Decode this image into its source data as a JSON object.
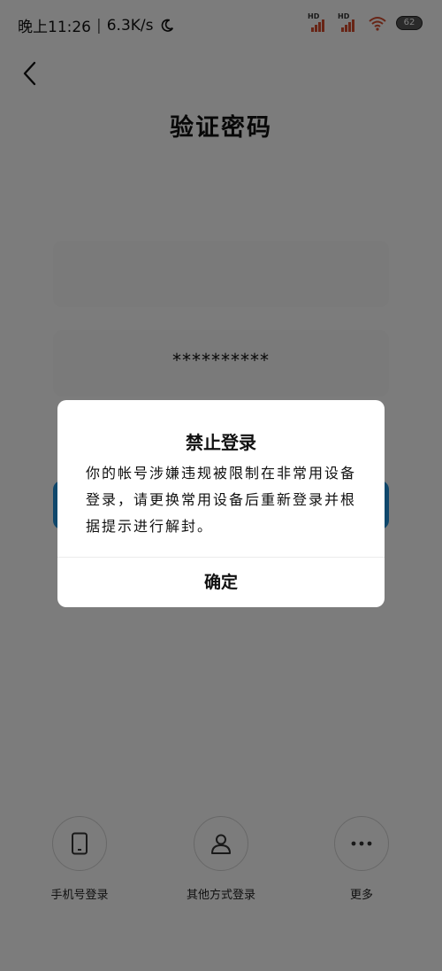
{
  "status_bar": {
    "time": "晚上11:26",
    "separator": "|",
    "net_speed": "6.3K/s",
    "signal1_label": "HD",
    "signal2_label": "HD",
    "battery": "62",
    "icons": [
      "moon-icon",
      "signal-icon",
      "signal-icon",
      "wifi-icon",
      "battery-icon"
    ]
  },
  "header": {
    "back_icon": "chevron-left-icon",
    "title": "验证密码"
  },
  "form": {
    "account_value": "",
    "password_value": "**********"
  },
  "options": [
    {
      "label": "手机号登录",
      "icon": "phone-icon"
    },
    {
      "label": "其他方式登录",
      "icon": "person-icon"
    },
    {
      "label": "更多",
      "icon": "more-icon"
    }
  ],
  "dialog": {
    "title": "禁止登录",
    "message": "你的帐号涉嫌违规被限制在非常用设备登录，请更换常用设备后重新登录并根据提示进行解封。",
    "confirm_label": "确定"
  },
  "colors": {
    "accent": "#1f8fd6",
    "overlay": "rgba(0,0,0,0.5)",
    "signal": "#d04a2c"
  }
}
